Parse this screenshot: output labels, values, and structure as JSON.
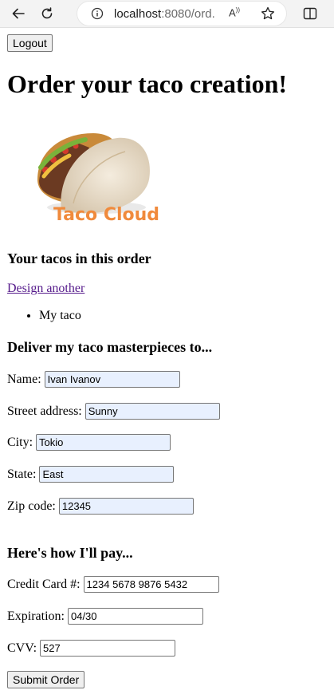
{
  "browser": {
    "url_host": "localhost",
    "url_rest": ":8080/ord...",
    "read_aloud_glyph": "Aₑ"
  },
  "page": {
    "logout_label": "Logout",
    "title": "Order your taco creation!",
    "logo_text": "Taco Cloud",
    "tacos_heading": "Your tacos in this order",
    "design_another_link": "Design another",
    "tacos": [
      "My taco"
    ],
    "deliver_heading": "Deliver my taco masterpieces to...",
    "pay_heading": "Here's how I'll pay...",
    "submit_label": "Submit Order"
  },
  "delivery": {
    "name_label": "Name:",
    "name_value": "Ivan Ivanov",
    "street_label": "Street address:",
    "street_value": "Sunny",
    "city_label": "City:",
    "city_value": "Tokio",
    "state_label": "State:",
    "state_value": "East",
    "zip_label": "Zip code:",
    "zip_value": "12345"
  },
  "payment": {
    "cc_label": "Credit Card #:",
    "cc_value": "1234 5678 9876 5432",
    "exp_label": "Expiration:",
    "exp_value": "04/30",
    "cvv_label": "CVV:",
    "cvv_value": "527"
  },
  "colors": {
    "autofill_bg": "#e8f0fe",
    "logo_orange": "#f08a3c",
    "link_visited": "#551a8b"
  }
}
